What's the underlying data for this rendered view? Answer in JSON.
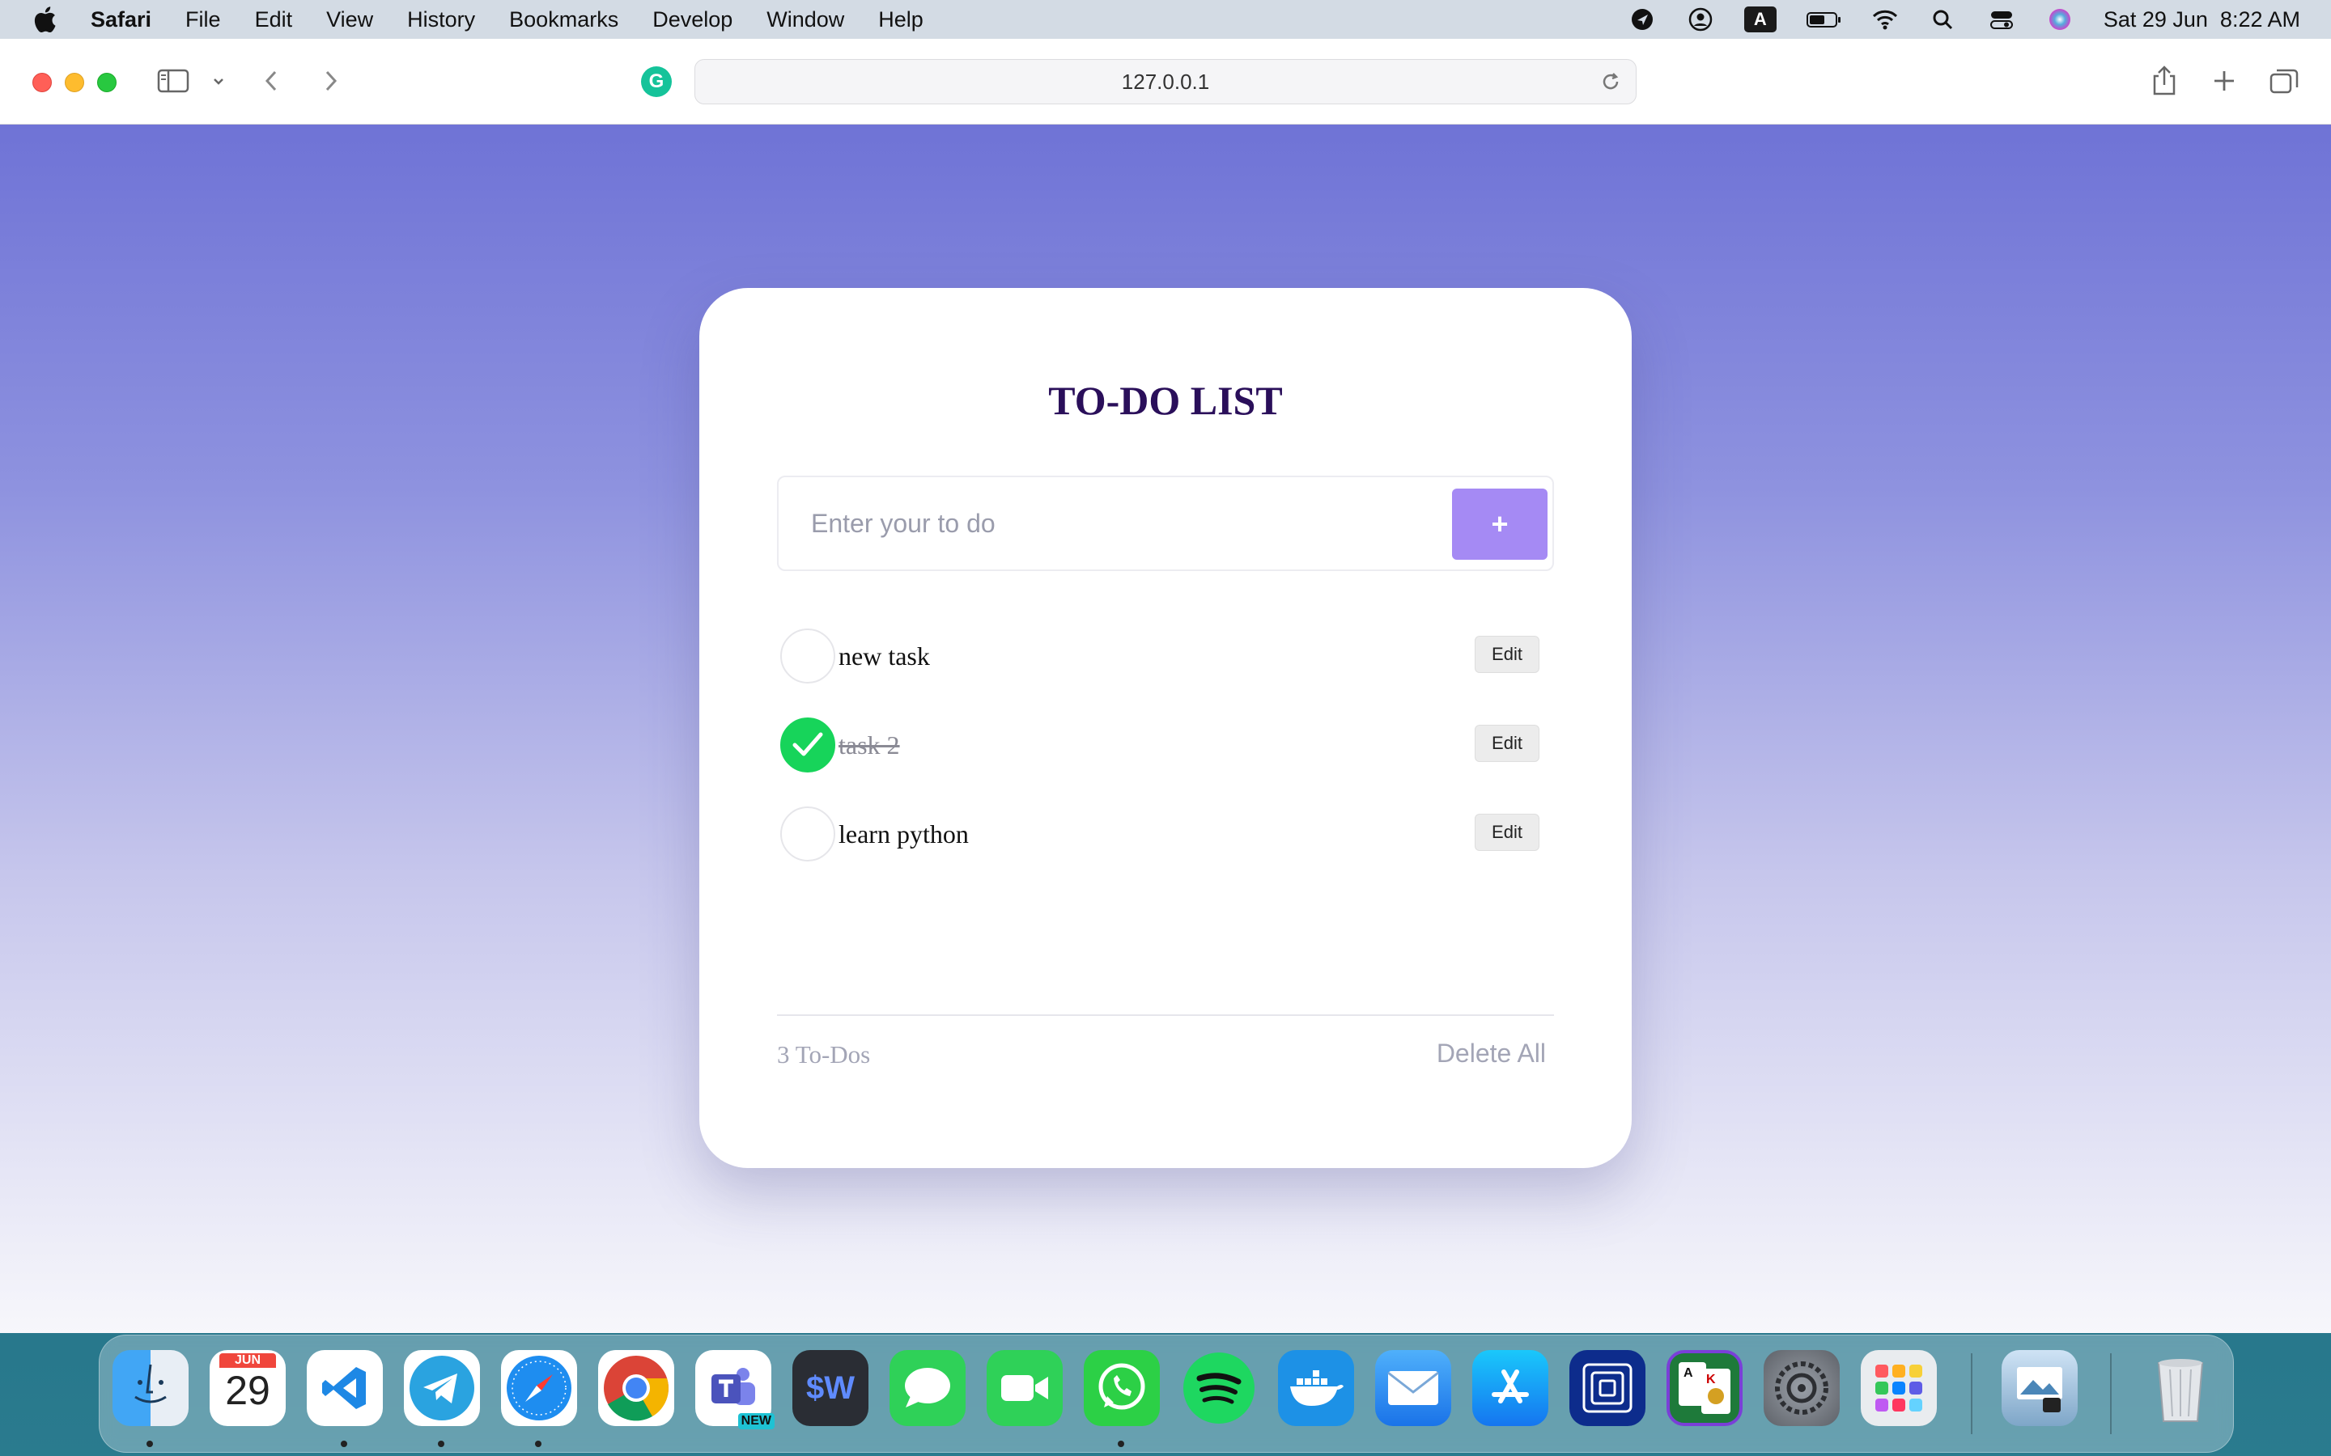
{
  "menubar": {
    "app_name": "Safari",
    "menus": [
      "File",
      "Edit",
      "View",
      "History",
      "Bookmarks",
      "Develop",
      "Window",
      "Help"
    ],
    "status_icons": [
      "location-icon",
      "user-circle-icon",
      "keyboard-input-icon",
      "battery-icon",
      "wifi-icon",
      "spotlight-icon",
      "control-center-icon",
      "siri-icon"
    ],
    "input_letter": "A",
    "datetime": "Sat 29 Jun  8:22 AM"
  },
  "browser": {
    "url": "127.0.0.1",
    "grammarly_letter": "G"
  },
  "app": {
    "title": "TO-DO LIST",
    "input_placeholder": "Enter your to do",
    "add_label": "+",
    "todos": [
      {
        "text": "new task",
        "done": false,
        "edit_label": "Edit"
      },
      {
        "text": "task 2",
        "done": true,
        "edit_label": "Edit"
      },
      {
        "text": "learn python",
        "done": false,
        "edit_label": "Edit"
      }
    ],
    "count_label": "3 To-Dos",
    "delete_all_label": "Delete All"
  },
  "dock": {
    "calendar_month": "JUN",
    "calendar_day": "29",
    "teams_badge": "NEW",
    "apps": [
      "finder",
      "calendar",
      "vscode",
      "telegram",
      "safari",
      "chrome",
      "teams",
      "wave",
      "messages",
      "facetime",
      "whatsapp",
      "spotify",
      "docker",
      "mail",
      "app-store",
      "screen-app",
      "solitaire",
      "system-settings",
      "launchpad",
      "preview",
      "trash"
    ]
  }
}
